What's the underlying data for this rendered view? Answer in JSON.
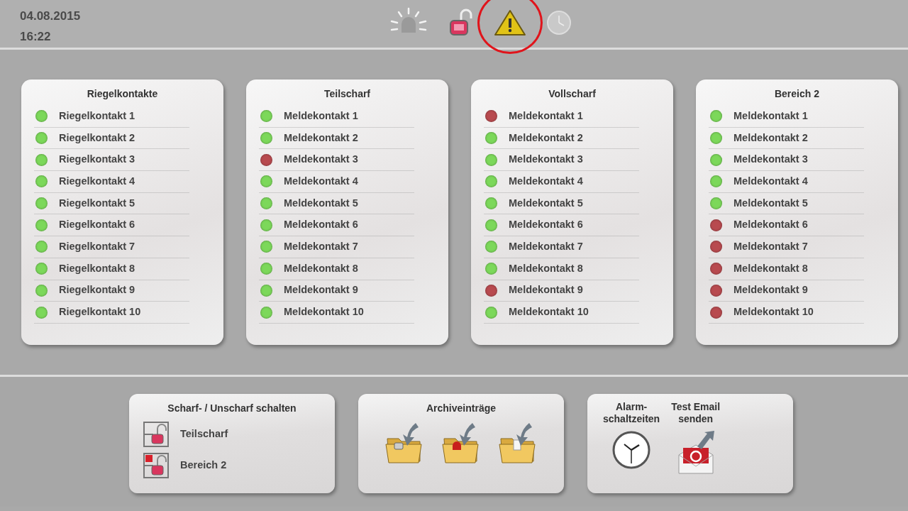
{
  "header": {
    "date": "04.08.2015",
    "time": "16:22",
    "status_icons": [
      {
        "kind": "beacon",
        "highlighted": false
      },
      {
        "kind": "padlock",
        "highlighted": false
      },
      {
        "kind": "warning",
        "highlighted": true
      },
      {
        "kind": "clock",
        "highlighted": false
      }
    ]
  },
  "groups": [
    {
      "title": "Riegelkontakte",
      "items": [
        {
          "label": "Riegelkontakt 1",
          "color": "#7cd85a"
        },
        {
          "label": "Riegelkontakt 2",
          "color": "#7cd85a"
        },
        {
          "label": "Riegelkontakt 3",
          "color": "#7cd85a"
        },
        {
          "label": "Riegelkontakt 4",
          "color": "#7cd85a"
        },
        {
          "label": "Riegelkontakt 5",
          "color": "#7cd85a"
        },
        {
          "label": "Riegelkontakt 6",
          "color": "#7cd85a"
        },
        {
          "label": "Riegelkontakt 7",
          "color": "#7cd85a"
        },
        {
          "label": "Riegelkontakt 8",
          "color": "#7cd85a"
        },
        {
          "label": "Riegelkontakt 9",
          "color": "#7cd85a"
        },
        {
          "label": "Riegelkontakt 10",
          "color": "#7cd85a"
        }
      ]
    },
    {
      "title": "Teilscharf",
      "items": [
        {
          "label": "Meldekontakt 1",
          "color": "#7cd85a"
        },
        {
          "label": "Meldekontakt 2",
          "color": "#7cd85a"
        },
        {
          "label": "Meldekontakt 3",
          "color": "#b84a4f"
        },
        {
          "label": "Meldekontakt 4",
          "color": "#7cd85a"
        },
        {
          "label": "Meldekontakt 5",
          "color": "#7cd85a"
        },
        {
          "label": "Meldekontakt 6",
          "color": "#7cd85a"
        },
        {
          "label": "Meldekontakt 7",
          "color": "#7cd85a"
        },
        {
          "label": "Meldekontakt 8",
          "color": "#7cd85a"
        },
        {
          "label": "Meldekontakt 9",
          "color": "#7cd85a"
        },
        {
          "label": "Meldekontakt 10",
          "color": "#7cd85a"
        }
      ]
    },
    {
      "title": "Vollscharf",
      "items": [
        {
          "label": "Meldekontakt 1",
          "color": "#b84a4f"
        },
        {
          "label": "Meldekontakt 2",
          "color": "#7cd85a"
        },
        {
          "label": "Meldekontakt 3",
          "color": "#7cd85a"
        },
        {
          "label": "Meldekontakt 4",
          "color": "#7cd85a"
        },
        {
          "label": "Meldekontakt 5",
          "color": "#7cd85a"
        },
        {
          "label": "Meldekontakt 6",
          "color": "#7cd85a"
        },
        {
          "label": "Meldekontakt 7",
          "color": "#7cd85a"
        },
        {
          "label": "Meldekontakt 8",
          "color": "#7cd85a"
        },
        {
          "label": "Meldekontakt 9",
          "color": "#b84a4f"
        },
        {
          "label": "Meldekontakt 10",
          "color": "#7cd85a"
        }
      ]
    },
    {
      "title": "Bereich 2",
      "items": [
        {
          "label": "Meldekontakt 1",
          "color": "#7cd85a"
        },
        {
          "label": "Meldekontakt 2",
          "color": "#7cd85a"
        },
        {
          "label": "Meldekontakt 3",
          "color": "#7cd85a"
        },
        {
          "label": "Meldekontakt 4",
          "color": "#7cd85a"
        },
        {
          "label": "Meldekontakt 5",
          "color": "#7cd85a"
        },
        {
          "label": "Meldekontakt 6",
          "color": "#b84a4f"
        },
        {
          "label": "Meldekontakt 7",
          "color": "#b84a4f"
        },
        {
          "label": "Meldekontakt 8",
          "color": "#b84a4f"
        },
        {
          "label": "Meldekontakt 9",
          "color": "#b84a4f"
        },
        {
          "label": "Meldekontakt 10",
          "color": "#b84a4f"
        }
      ]
    }
  ],
  "arming": {
    "title": "Scharf- / Unscharf schalten",
    "items": [
      {
        "label": "Teilscharf",
        "active": false
      },
      {
        "label": "Bereich 2",
        "active": true
      }
    ]
  },
  "archive": {
    "title": "Archiveinträge",
    "folders": [
      {
        "kind": "lock"
      },
      {
        "kind": "siren"
      },
      {
        "kind": "document"
      }
    ]
  },
  "tools": [
    {
      "kind": "clock",
      "label": "Alarm-\nschaltzeiten"
    },
    {
      "kind": "email",
      "label": "Test Email\nsenden"
    }
  ]
}
